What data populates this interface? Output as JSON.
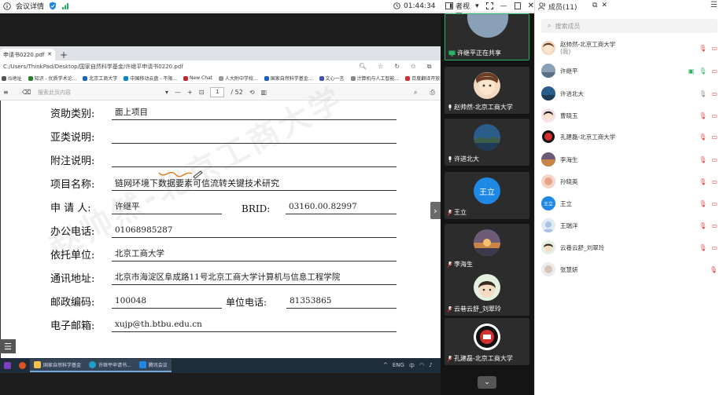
{
  "meetbar": {
    "title": "会议详情",
    "timer": "01:44:34",
    "view_mode": "演讲者视图",
    "members_tab": "成员(11)"
  },
  "browser": {
    "tab_title": "申请书0220.pdf",
    "address": "C:/Users/ThinkPad/Desktop/国家自然科学基金/许继平申请书0220.pdf",
    "bookmarks": [
      "IS地址",
      "知识 - 优质学术论...",
      "北京工商大学",
      "中国移动云盘 - 不限...",
      "New Chat",
      "人大附中学校...",
      "国家自然科学基金...",
      "文心一言",
      "计算机与人工智能...",
      "百度翻译开放平台"
    ],
    "find_placeholder": "搜索此页内容",
    "page_current": "1",
    "page_total": "/ 52"
  },
  "form": {
    "rows": [
      {
        "label": "资助类别:",
        "value": "面上项目"
      },
      {
        "label": "亚类说明:",
        "value": ""
      },
      {
        "label": "附注说明:",
        "value": ""
      },
      {
        "label": "项目名称:",
        "value": "链网环境下数据要素可信流转关键技术研究"
      },
      {
        "label": "申 请 人:",
        "value": "许继平"
      },
      {
        "label": "办公电话:",
        "value": "01068985287"
      },
      {
        "label": "依托单位:",
        "value": "北京工商大学"
      },
      {
        "label": "通讯地址:",
        "value": "北京市海淀区阜成路11号北京工商大学计算机与信息工程学院"
      },
      {
        "label": "邮政编码:",
        "value": "100048"
      },
      {
        "label": "电子邮箱:",
        "value": "xujp@th.btbu.edu.cn"
      }
    ],
    "brid_label": "BRID:",
    "brid_value": "03160.00.82997",
    "unit_phone_label": "单位电话:",
    "unit_phone_value": "81353865"
  },
  "taskbar": {
    "items": [
      "国家自然科学基金",
      "许继平申请书...",
      "腾讯会议"
    ],
    "tray": [
      "ENG",
      "中"
    ]
  },
  "video_tiles": [
    {
      "name": "许继平正在共享",
      "sharing": true
    },
    {
      "name": "赵帅然-北京工商大学",
      "sharing": false
    },
    {
      "name": "许进北大",
      "sharing": false
    },
    {
      "name": "王立",
      "initials": "王立",
      "sharing": false
    },
    {
      "name": "李海生",
      "sharing": false
    },
    {
      "name": "云巷云舒_刘翠玲",
      "sharing": false
    },
    {
      "name": "孔建磊-北京工商大学",
      "sharing": false
    }
  ],
  "panel": {
    "title": "成员(11)",
    "search_placeholder": "搜索成员",
    "members": [
      {
        "name": "赵帅然-北京工商大学",
        "note": "(我)"
      },
      {
        "name": "许继平",
        "note": ""
      },
      {
        "name": "许进北大",
        "note": ""
      },
      {
        "name": "曹晓玉",
        "note": ""
      },
      {
        "name": "孔建磊-北京工商大学",
        "note": ""
      },
      {
        "name": "李海生",
        "note": ""
      },
      {
        "name": "孙晓英",
        "note": ""
      },
      {
        "name": "王立",
        "note": ""
      },
      {
        "name": "王瑞洋",
        "note": ""
      },
      {
        "name": "云巷云舒_刘翠玲",
        "note": ""
      },
      {
        "name": "张慧妍",
        "note": ""
      }
    ]
  },
  "colors": {
    "share_green": "#28b463",
    "meeting_blue": "#1e88e5",
    "taskbar": "#1f2d3b"
  }
}
